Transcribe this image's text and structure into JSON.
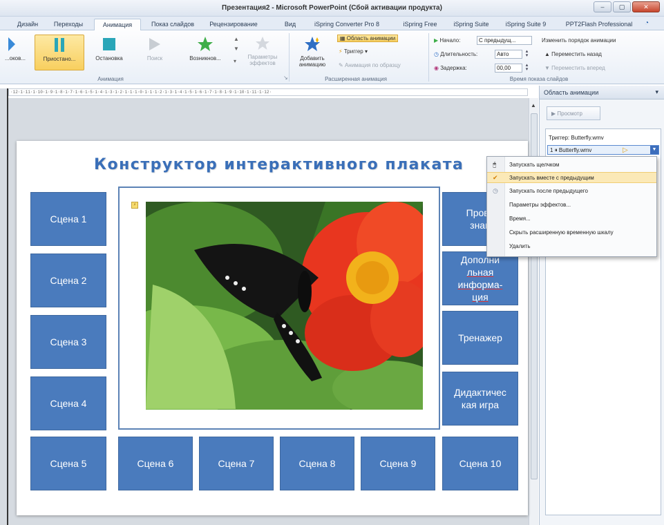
{
  "window": {
    "title": "Презентация2 - Microsoft PowerPoint (Сбой активации продукта)",
    "controls": {
      "minimize": "–",
      "maximize": "▢",
      "close": "✕"
    }
  },
  "tabs": [
    "Дизайн",
    "Переходы",
    "Анимация",
    "Показ слайдов",
    "Рецензирование",
    "Вид",
    "iSpring Converter Pro 8",
    "iSpring Free",
    "iSpring Suite",
    "iSpring Suite 9",
    "PPT2Flash Professional"
  ],
  "ribbon": {
    "effects": [
      "...оков...",
      "Приостано...",
      "Остановка",
      "Поиск",
      "Возникнов..."
    ],
    "effect_params": "Параметры эффектов",
    "group_animation": "Анимация",
    "add_animation": "Добавить анимацию",
    "animation_pane": "Область анимации",
    "trigger": "Триггер",
    "animation_painter": "Анимация по образцу",
    "group_advanced": "Расширенная анимация",
    "start_label": "Начало:",
    "start_value": "С предыдущ...",
    "duration_label": "Длительность:",
    "duration_value": "Авто",
    "delay_label": "Задержка:",
    "delay_value": "00,00",
    "reorder_title": "Изменить порядок анимации",
    "move_earlier": "Переместить назад",
    "move_later": "Переместить вперед",
    "group_timing": "Время показа слайдов"
  },
  "ruler": "·12·1·11·1·10·1·9·1·8·1·7·1·6·1·5·1·4·1·3·1·2·1·1·1·0·1·1·1·2·1·3·1·4·1·5·1·6·1·7·1·8·1·9·1·10·1·11·1·12·",
  "slide": {
    "title": "Конструктор интерактивного плаката",
    "scenes": [
      "Сцена 1",
      "Сцена 2",
      "Сцена 3",
      "Сцена 4",
      "Сцена 5",
      "Сцена 6",
      "Сцена 7",
      "Сцена 8",
      "Сцена 9",
      "Сцена 10"
    ],
    "right_boxes": [
      "Прове... знан...",
      "Дополни-льная информа-ция",
      "Тренажер",
      "Дидактическая игра"
    ],
    "right_box_1_line1": "Прове",
    "right_box_1_line2": "знан",
    "right_box_2_line1": "Дополни",
    "right_box_2_line2": "льная",
    "right_box_2_line3": "информа-",
    "right_box_2_line4": "ция",
    "right_box_3": "Тренажер",
    "right_box_4_line1": "Дидактичес",
    "right_box_4_line2": "кая игра"
  },
  "pane": {
    "title": "Область анимации",
    "preview": "Просмотр",
    "trigger_label": "Триггер: Butterfly.wmv",
    "item_index": "1",
    "item_name": "Butterfly.wmv"
  },
  "context_menu": {
    "items": [
      "Запускать щелчком",
      "Запускать вместе с предыдущим",
      "Запускать после предыдущего",
      "Параметры эффектов...",
      "Время...",
      "Скрыть расширенную временную шкалу",
      "Удалить"
    ]
  },
  "colors": {
    "scene_blue": "#4a7bbd",
    "title_blue": "#3a6fb8",
    "highlight": "#fbe9b7"
  }
}
